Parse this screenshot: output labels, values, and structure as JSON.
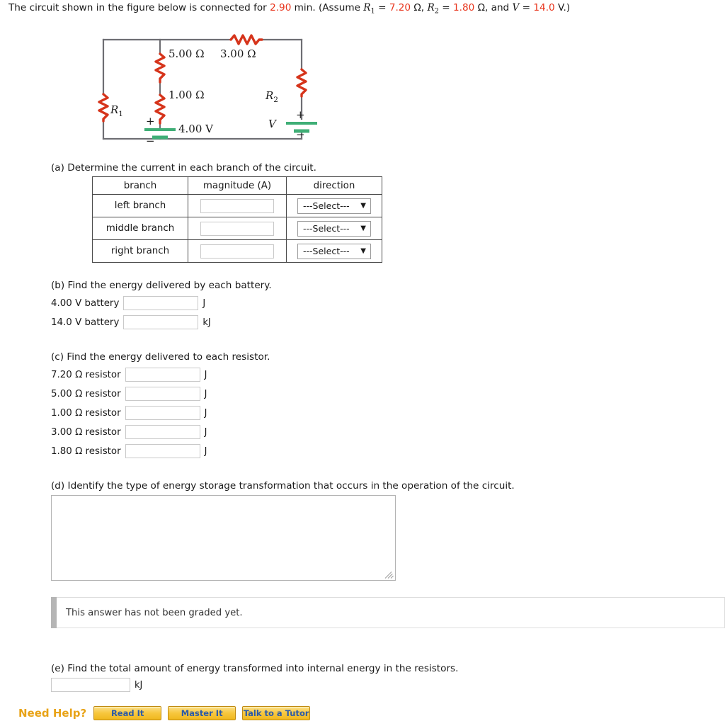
{
  "prompt": {
    "text_1": "The circuit shown in the figure below is connected for ",
    "time_value": "2.90",
    "text_2": " min. (Assume ",
    "r1_symbol": "R",
    "r1_sub": "1",
    "eq_1": " = ",
    "r1_value": "7.20",
    "ohm_1": " Ω, ",
    "r2_symbol": "R",
    "r2_sub": "2",
    "eq_2": " = ",
    "r2_value": "1.80",
    "ohm_2": " Ω, and ",
    "v_symbol": "V",
    "eq_3": " = ",
    "v_value": "14.0",
    "text_3": " V.)"
  },
  "figure": {
    "label_5ohm": "5.00 Ω",
    "label_3ohm": "3.00 Ω",
    "label_1ohm": "1.00 Ω",
    "label_r1": "R",
    "label_r1_sub": "1",
    "label_r2": "R",
    "label_r2_sub": "2",
    "label_v": "V",
    "label_4v": "4.00 V",
    "plus_left": "+",
    "minus_left": "−",
    "plus_right": "+",
    "minus_right": "−",
    "colors": {
      "wire": "#6e6e73",
      "resistor": "#d6341b",
      "battery": "#3fae76"
    }
  },
  "part_a": {
    "label": "(a) Determine the current in each branch of the circuit.",
    "columns": [
      "branch",
      "magnitude (A)",
      "direction"
    ],
    "rows": [
      {
        "branch": "left branch",
        "magnitude": "",
        "direction": "---Select---"
      },
      {
        "branch": "middle branch",
        "magnitude": "",
        "direction": "---Select---"
      },
      {
        "branch": "right branch",
        "magnitude": "",
        "direction": "---Select---"
      }
    ],
    "caret": "▼"
  },
  "part_b": {
    "label": "(b) Find the energy delivered by each battery.",
    "rows": [
      {
        "label": "4.00 V battery",
        "value": "",
        "unit": "J"
      },
      {
        "label": "14.0 V battery",
        "value": "",
        "unit": "kJ"
      }
    ]
  },
  "part_c": {
    "label": "(c) Find the energy delivered to each resistor.",
    "rows": [
      {
        "label": "7.20 Ω resistor",
        "value": "",
        "unit": "J"
      },
      {
        "label": "5.00 Ω resistor",
        "value": "",
        "unit": "J"
      },
      {
        "label": "1.00 Ω resistor",
        "value": "",
        "unit": "J"
      },
      {
        "label": "3.00 Ω resistor",
        "value": "",
        "unit": "J"
      },
      {
        "label": "1.80 Ω resistor",
        "value": "",
        "unit": "J"
      }
    ]
  },
  "part_d": {
    "label": "(d) Identify the type of energy storage transformation that occurs in the operation of the circuit.",
    "answer": "",
    "notice": "This answer has not been graded yet."
  },
  "part_e": {
    "label": "(e) Find the total amount of energy transformed into internal energy in the resistors.",
    "value": "",
    "unit": "kJ"
  },
  "need_help": {
    "title": "Need Help?",
    "buttons": [
      "Read It",
      "Master It",
      "Talk to a Tutor"
    ]
  }
}
